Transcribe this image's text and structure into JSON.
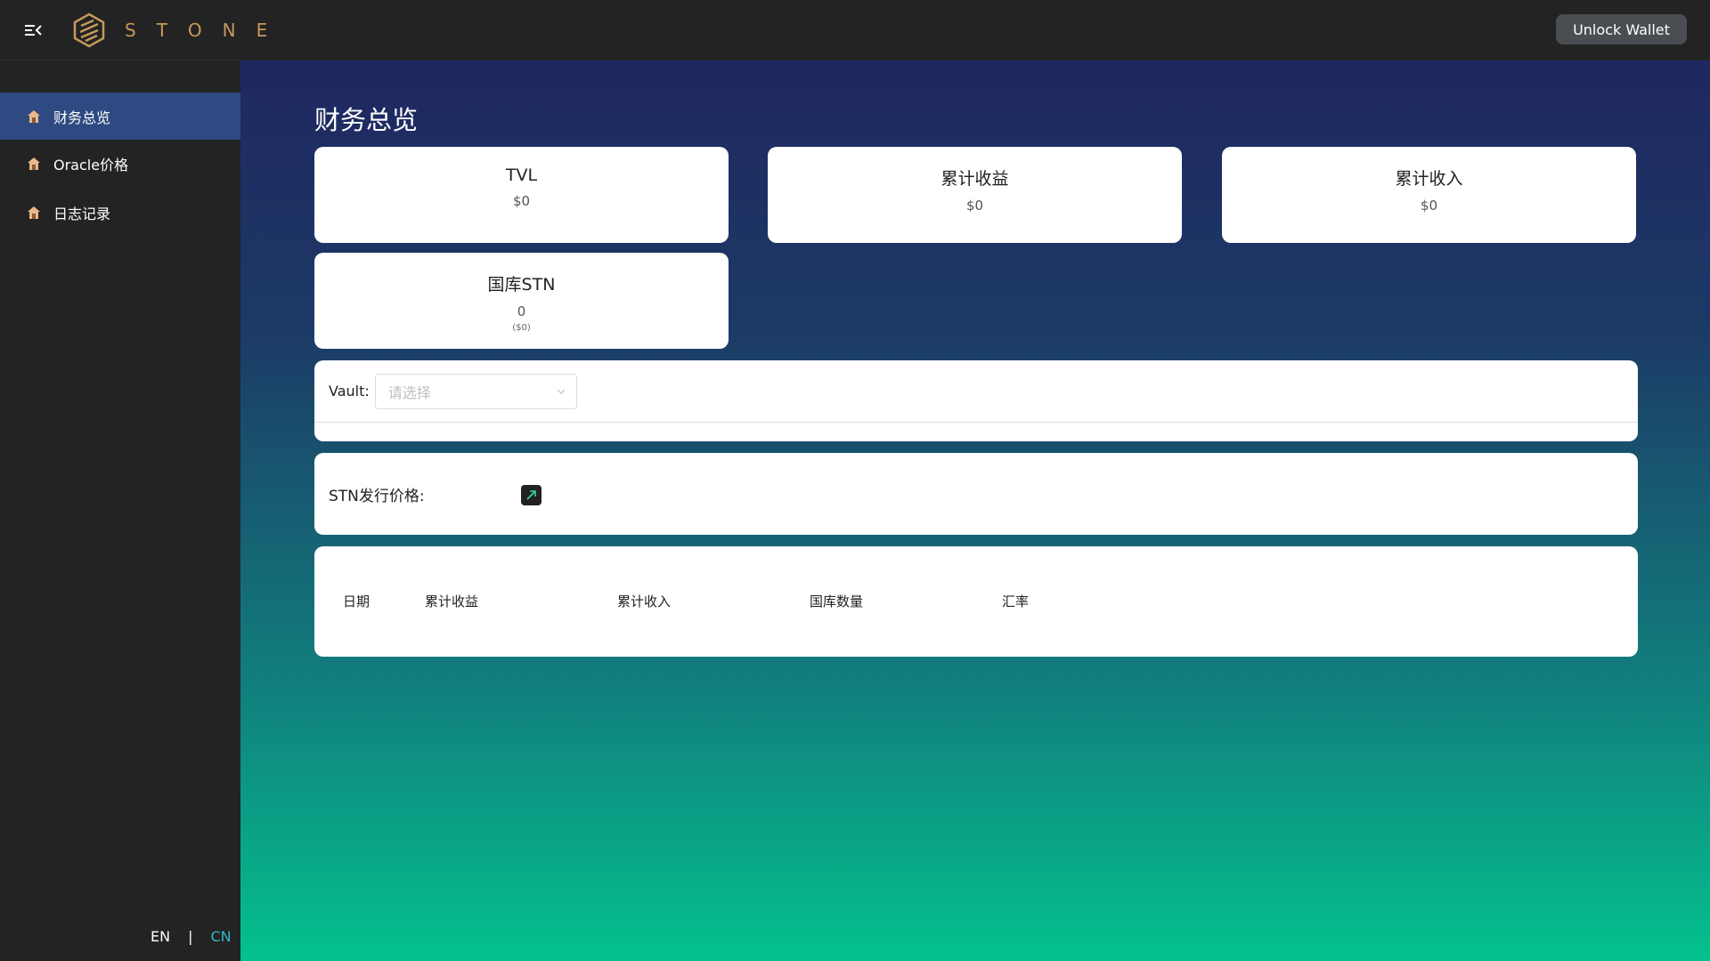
{
  "header": {
    "logo_text": "STONE",
    "unlock_wallet_label": "Unlock Wallet",
    "icons": {
      "menu": "menu-collapse-icon",
      "logo": "stone-logo-icon"
    }
  },
  "sidebar": {
    "items": [
      {
        "label": "财务总览",
        "icon": "home-icon",
        "active": true
      },
      {
        "label": "Oracle价格",
        "icon": "home-icon",
        "active": false
      },
      {
        "label": "日志记录",
        "icon": "home-icon",
        "active": false
      }
    ],
    "language": {
      "en": "EN",
      "separator": "|",
      "cn": "CN",
      "active": "CN"
    }
  },
  "main": {
    "title": "财务总览",
    "stats": [
      {
        "title": "TVL",
        "value": "$0"
      },
      {
        "title": "累计收益",
        "value": "$0"
      },
      {
        "title": "累计收入",
        "value": "$0"
      },
      {
        "title": "国库STN",
        "value": "0",
        "sub": "($0)"
      }
    ],
    "vault": {
      "label": "Vault:",
      "placeholder": "请选择"
    },
    "price": {
      "label": "STN发行价格:",
      "link_icon": "external-link-icon"
    },
    "table": {
      "headers": [
        "日期",
        "累计收益",
        "累计收入",
        "国库数量",
        "汇率"
      ]
    }
  },
  "colors": {
    "accent_active": "#2f4a82",
    "logo_gold": "#c59a5b",
    "lang_active": "#2fb6c9",
    "gradient_top": "#1f2760",
    "gradient_bottom": "#04c18e"
  }
}
